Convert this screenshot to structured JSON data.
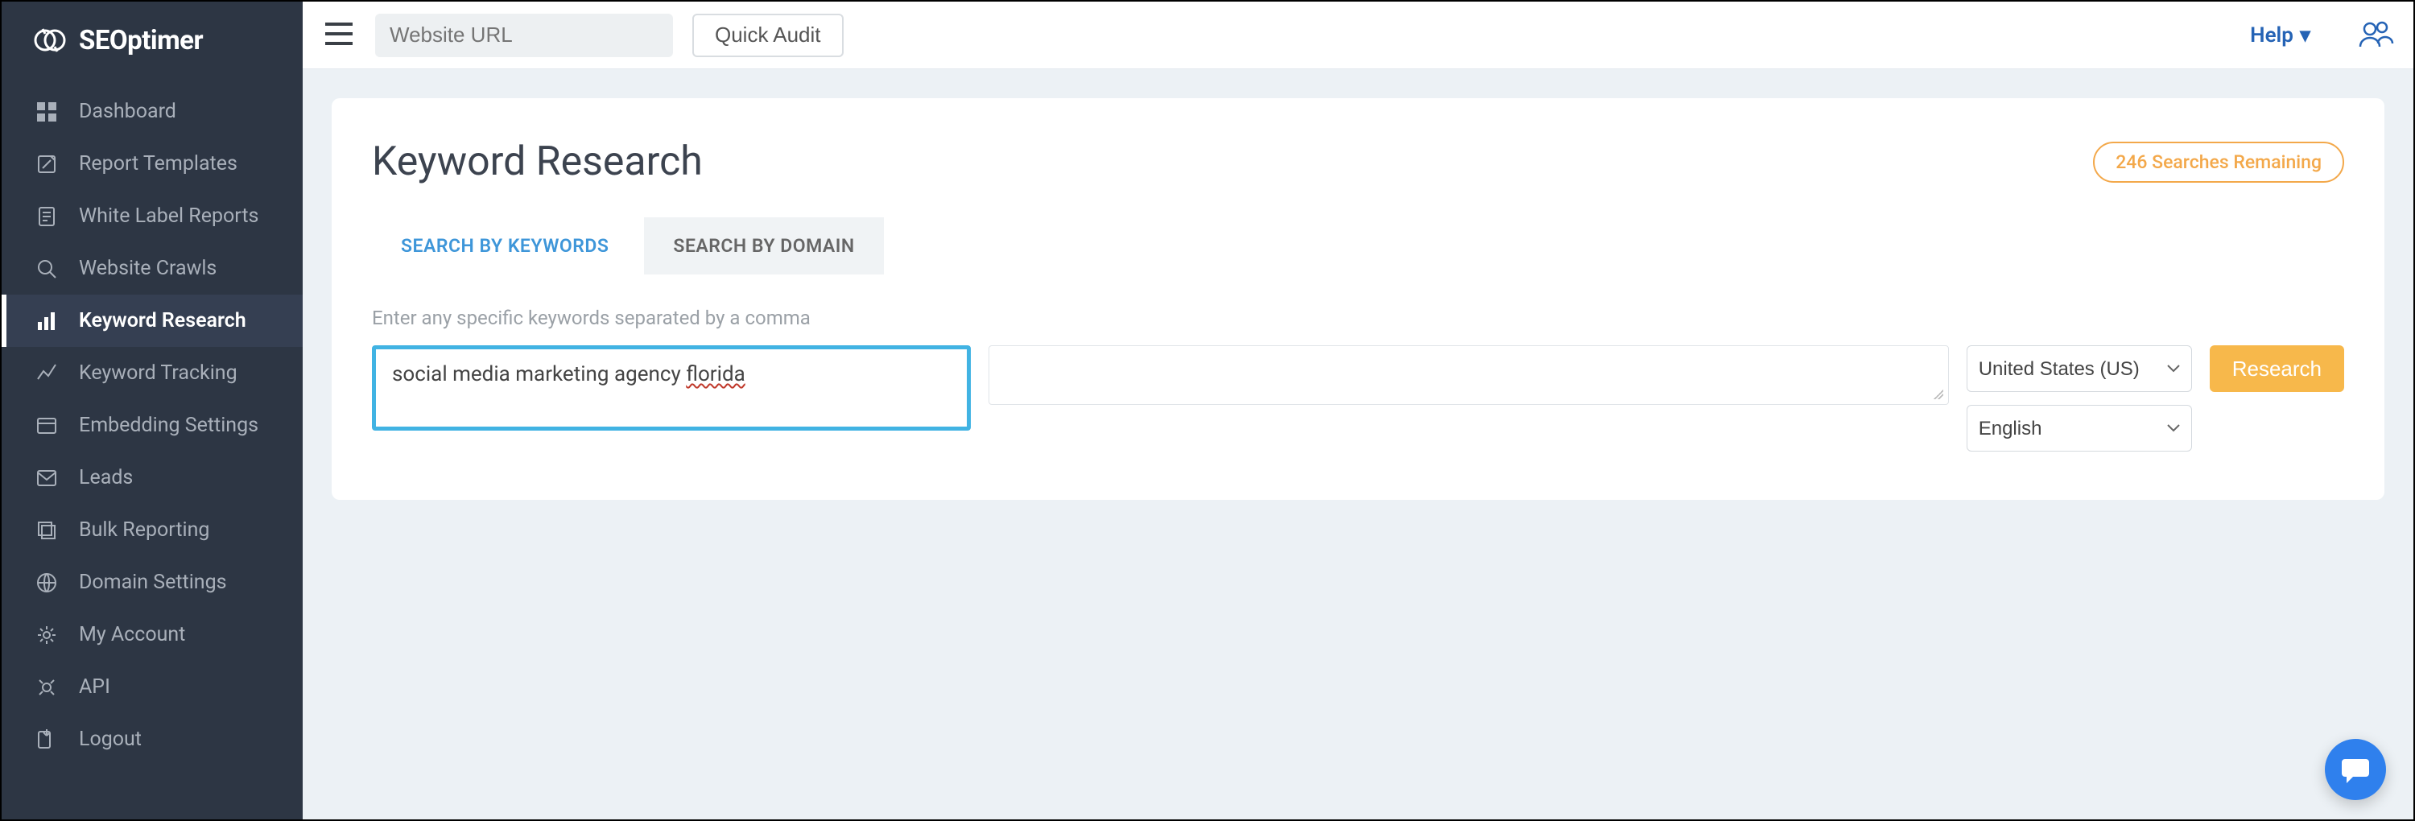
{
  "brand": "SEOptimer",
  "topbar": {
    "url_placeholder": "Website URL",
    "quick_audit": "Quick Audit",
    "help": "Help"
  },
  "sidebar": {
    "items": [
      {
        "icon": "dashboard",
        "label": "Dashboard"
      },
      {
        "icon": "report",
        "label": "Report Templates"
      },
      {
        "icon": "whitelabel",
        "label": "White Label Reports"
      },
      {
        "icon": "crawl",
        "label": "Website Crawls"
      },
      {
        "icon": "keyword",
        "label": "Keyword Research",
        "active": true
      },
      {
        "icon": "tracking",
        "label": "Keyword Tracking"
      },
      {
        "icon": "embed",
        "label": "Embedding Settings"
      },
      {
        "icon": "leads",
        "label": "Leads"
      },
      {
        "icon": "bulk",
        "label": "Bulk Reporting"
      },
      {
        "icon": "globe",
        "label": "Domain Settings"
      },
      {
        "icon": "gear",
        "label": "My Account"
      },
      {
        "icon": "api",
        "label": "API"
      },
      {
        "icon": "logout",
        "label": "Logout"
      }
    ]
  },
  "page": {
    "title": "Keyword Research",
    "remaining": "246 Searches Remaining",
    "tabs": [
      "SEARCH BY KEYWORDS",
      "SEARCH BY DOMAIN"
    ],
    "active_tab": 0,
    "prompt": "Enter any specific keywords separated by a comma",
    "keyword_plain": "social media marketing agency ",
    "keyword_wavy": "florida",
    "country": "United States (US)",
    "language": "English",
    "button": "Research"
  }
}
